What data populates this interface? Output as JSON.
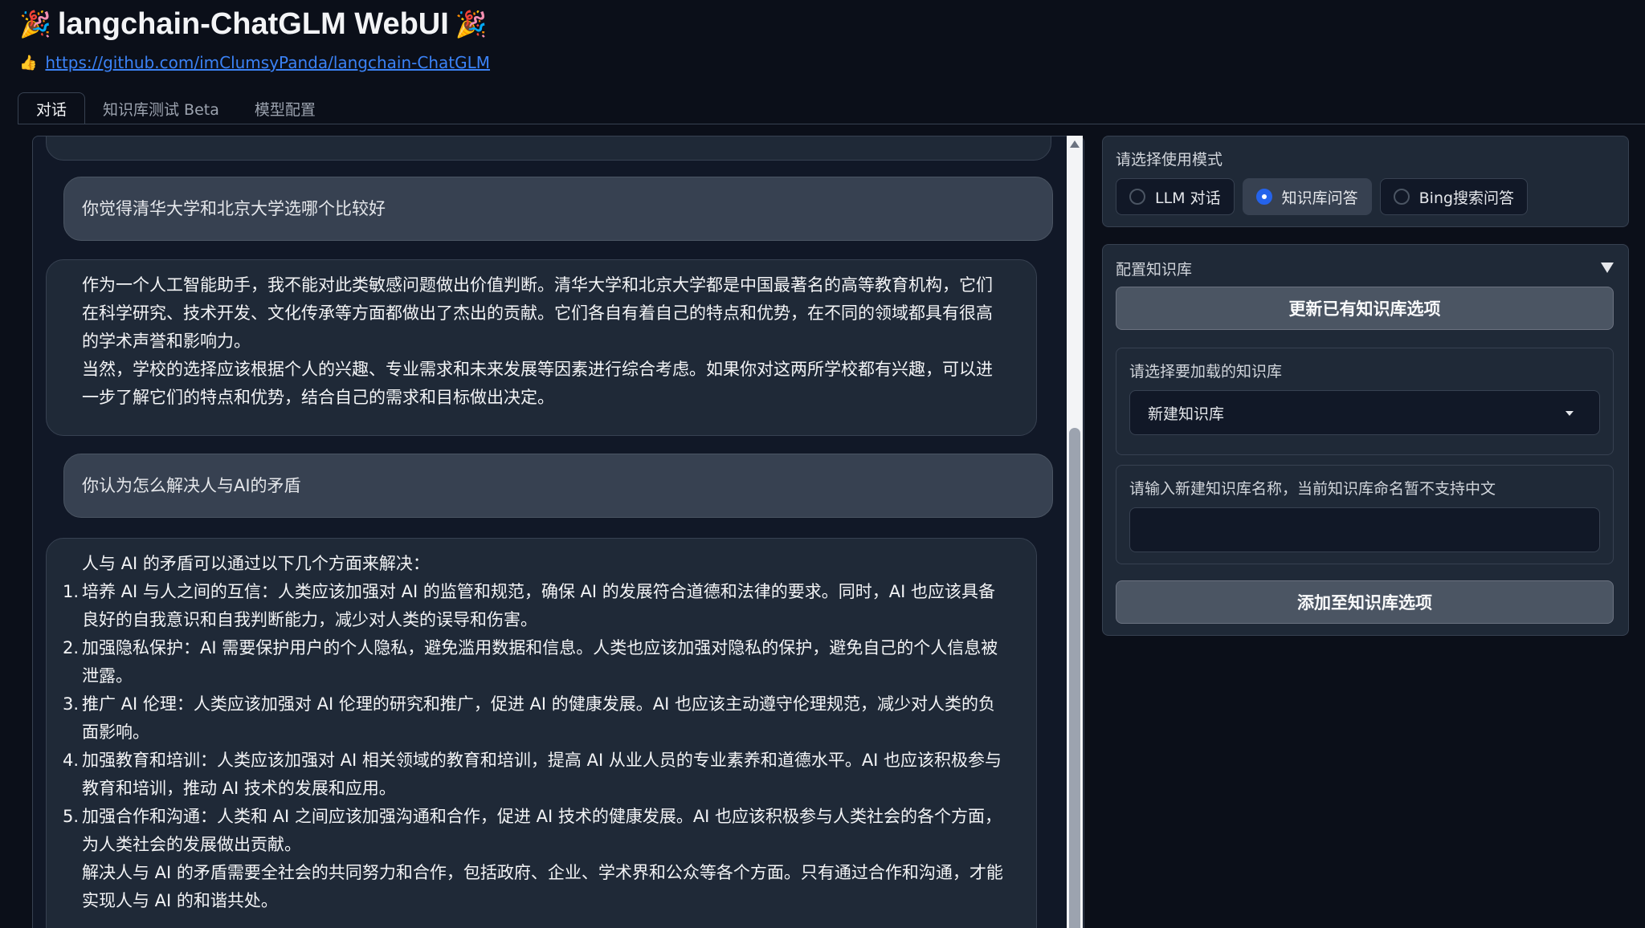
{
  "header": {
    "title": "langchain-ChatGLM WebUI",
    "title_icon": "party-popper-icon",
    "link_icon": "thumbs-up-icon",
    "link_text": "https://github.com/imClumsyPanda/langchain-ChatGLM"
  },
  "tabs": [
    {
      "label": "对话",
      "active": true
    },
    {
      "label": "知识库测试 Beta",
      "active": false
    },
    {
      "label": "模型配置",
      "active": false
    }
  ],
  "chat": {
    "messages": [
      {
        "role": "user",
        "text": "你觉得清华大学和北京大学选哪个比较好"
      },
      {
        "role": "assistant",
        "paragraphs": [
          "作为一个人工智能助手，我不能对此类敏感问题做出价值判断。清华大学和北京大学都是中国最著名的高等教育机构，它们在科学研究、技术开发、文化传承等方面都做出了杰出的贡献。它们各自有着自己的特点和优势，在不同的领域都具有很高的学术声誉和影响力。",
          "当然，学校的选择应该根据个人的兴趣、专业需求和未来发展等因素进行综合考虑。如果你对这两所学校都有兴趣，可以进一步了解它们的特点和优势，结合自己的需求和目标做出决定。"
        ]
      },
      {
        "role": "user",
        "text": "你认为怎么解决人与AI的矛盾"
      },
      {
        "role": "assistant",
        "intro": "人与 AI 的矛盾可以通过以下几个方面来解决：",
        "items": [
          "培养 AI 与人之间的互信：人类应该加强对 AI 的监管和规范，确保 AI 的发展符合道德和法律的要求。同时，AI 也应该具备良好的自我意识和自我判断能力，减少对人类的误导和伤害。",
          "加强隐私保护：AI 需要保护用户的个人隐私，避免滥用数据和信息。人类也应该加强对隐私的保护，避免自己的个人信息被泄露。",
          "推广 AI 伦理：人类应该加强对 AI 伦理的研究和推广，促进 AI 的健康发展。AI 也应该主动遵守伦理规范，减少对人类的负面影响。",
          "加强教育和培训：人类应该加强对 AI 相关领域的教育和培训，提高 AI 从业人员的专业素养和道德水平。AI 也应该积极参与教育和培训，推动 AI 技术的发展和应用。",
          "加强合作和沟通：人类和 AI 之间应该加强沟通和合作，促进 AI 技术的健康发展。AI 也应该积极参与人类社会的各个方面，为人类社会的发展做出贡献。"
        ],
        "outro": "解决人与 AI 的矛盾需要全社会的共同努力和合作，包括政府、企业、学术界和公众等各个方面。只有通过合作和沟通，才能实现人与 AI 的和谐共处。"
      }
    ]
  },
  "mode": {
    "label": "请选择使用模式",
    "options": [
      {
        "label": "LLM 对话",
        "selected": false
      },
      {
        "label": "知识库问答",
        "selected": true
      },
      {
        "label": "Bing搜索问答",
        "selected": false
      }
    ]
  },
  "kb": {
    "section_title": "配置知识库",
    "collapse_icon": "collapse-triangle-icon",
    "refresh_button": "更新已有知识库选项",
    "select_label": "请选择要加载的知识库",
    "select_value": "新建知识库",
    "name_label": "请输入新建知识库名称，当前知识库命名暂不支持中文",
    "name_value": "",
    "add_button": "添加至知识库选项"
  }
}
